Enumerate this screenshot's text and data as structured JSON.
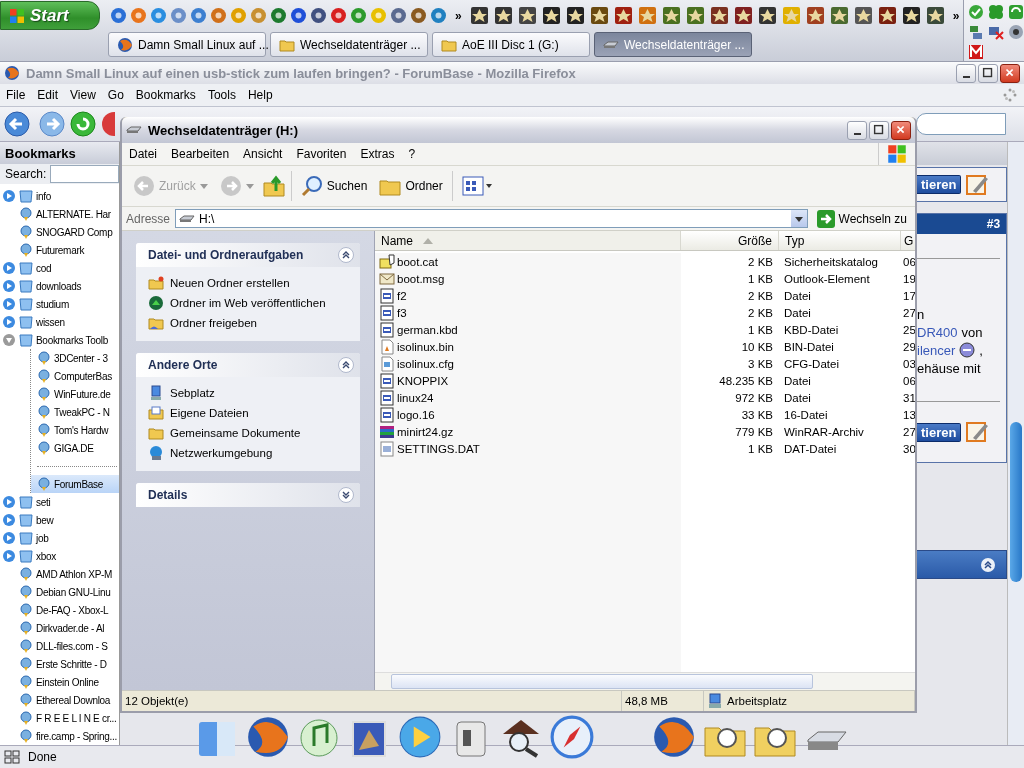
{
  "taskbar": {
    "start": "Start",
    "overflow_marks": [
      "»",
      "»"
    ],
    "tasks": [
      {
        "label": "Damn Small Linux auf ...",
        "kind": "browser",
        "selected": false
      },
      {
        "label": "Wechseldatenträger ...",
        "kind": "folder",
        "selected": false
      },
      {
        "label": "AoE III Disc 1 (G:)",
        "kind": "folder",
        "selected": false
      },
      {
        "label": "Wechseldatenträger ...",
        "kind": "drive",
        "selected": true
      }
    ]
  },
  "browser": {
    "title": "Damn Small Linux auf einen usb-stick zum laufen bringen? - ForumBase - Mozilla Firefox",
    "menu": [
      "File",
      "Edit",
      "View",
      "Go",
      "Bookmarks",
      "Tools",
      "Help"
    ],
    "sidebar": {
      "title": "Bookmarks",
      "search_label": "Search:",
      "items": [
        {
          "label": "info",
          "kind": "folder",
          "expanded": false
        },
        {
          "label": "ALTERNATE. Har",
          "kind": "link",
          "selected": false
        },
        {
          "label": "SNOGARD Comp",
          "kind": "link",
          "selected": false
        },
        {
          "label": "Futuremark",
          "kind": "link",
          "selected": false
        },
        {
          "label": "cod",
          "kind": "folder",
          "expanded": false
        },
        {
          "label": "downloads",
          "kind": "folder",
          "expanded": false
        },
        {
          "label": "studium",
          "kind": "folder",
          "expanded": false
        },
        {
          "label": "wissen",
          "kind": "folder",
          "expanded": false
        },
        {
          "label": "Bookmarks Toolb",
          "kind": "folder",
          "expanded": true,
          "children": [
            {
              "label": "3DCenter - 3",
              "kind": "link",
              "selected": false
            },
            {
              "label": "ComputerBas",
              "kind": "link",
              "selected": false
            },
            {
              "label": "WinFuture.de",
              "kind": "link",
              "selected": false
            },
            {
              "label": "TweakPC - N",
              "kind": "link",
              "selected": false
            },
            {
              "label": "Tom's Hardw",
              "kind": "link",
              "selected": false
            },
            {
              "label": "GIGA.DE",
              "kind": "link",
              "selected": false
            },
            {
              "kind": "separator"
            },
            {
              "label": "ForumBase",
              "kind": "link",
              "selected": true
            }
          ]
        },
        {
          "label": "seti",
          "kind": "folder",
          "expanded": false
        },
        {
          "label": "bew",
          "kind": "folder",
          "expanded": false
        },
        {
          "label": "job",
          "kind": "folder",
          "expanded": false
        },
        {
          "label": "xbox",
          "kind": "folder",
          "expanded": false
        },
        {
          "label": "AMD Athlon XP-M",
          "kind": "link",
          "selected": false
        },
        {
          "label": "Debian GNU-Linu",
          "kind": "link",
          "selected": false
        },
        {
          "label": "De-FAQ - Xbox-L",
          "kind": "link",
          "selected": false
        },
        {
          "label": "Dirkvader.de - Al",
          "kind": "link",
          "selected": false
        },
        {
          "label": "DLL-files.com - S",
          "kind": "link",
          "selected": false
        },
        {
          "label": "Erste Schritte - D",
          "kind": "link",
          "selected": false
        },
        {
          "label": "Einstein Online",
          "kind": "link",
          "selected": false
        },
        {
          "label": "Ethereal Downloa",
          "kind": "link",
          "selected": false
        },
        {
          "label": "F R E E L I N E cr...",
          "kind": "link",
          "selected": false
        },
        {
          "label": "fire.camp - Spring...",
          "kind": "link",
          "selected": false
        }
      ]
    },
    "page": {
      "buttons": [
        "tieren",
        "tieren"
      ],
      "post_number": "#3",
      "lines": [
        [
          {
            "kind": "text",
            "text": "n"
          }
        ],
        [
          {
            "kind": "link",
            "text": "DR400"
          },
          {
            "kind": "text",
            "text": "von"
          }
        ],
        [
          {
            "kind": "link",
            "text": "ilencer"
          },
          {
            "kind": "smiley"
          },
          {
            "kind": "text",
            "text": ","
          }
        ],
        [
          {
            "kind": "text",
            "text": "ehäuse mit"
          }
        ]
      ]
    },
    "status": "Done"
  },
  "explorer": {
    "title": "Wechseldatenträger (H:)",
    "menu": [
      "Datei",
      "Bearbeiten",
      "Ansicht",
      "Favoriten",
      "Extras",
      "?"
    ],
    "toolbar": {
      "back": {
        "label": "Zurück",
        "disabled": true
      },
      "forward": {
        "disabled": true
      },
      "search": "Suchen",
      "folders": "Ordner"
    },
    "address": {
      "label": "Adresse",
      "value": "H:\\",
      "go": "Wechseln zu"
    },
    "panels": [
      {
        "title": "Datei- und Ordneraufgaben",
        "expanded": true,
        "items": [
          {
            "label": "Neuen Ordner erstellen",
            "kind": "newfolder"
          },
          {
            "label": "Ordner im Web veröffentlichen",
            "kind": "publish"
          },
          {
            "label": "Ordner freigeben",
            "kind": "share"
          }
        ]
      },
      {
        "title": "Andere Orte",
        "expanded": true,
        "items": [
          {
            "label": "Sebplatz",
            "kind": "computer"
          },
          {
            "label": "Eigene Dateien",
            "kind": "documents"
          },
          {
            "label": "Gemeinsame Dokumente",
            "kind": "folder"
          },
          {
            "label": "Netzwerkumgebung",
            "kind": "network"
          }
        ]
      },
      {
        "title": "Details",
        "expanded": false
      }
    ],
    "columns": [
      {
        "label": "Name",
        "sorted": true
      },
      {
        "label": "Größe",
        "sorted": false
      },
      {
        "label": "Typ",
        "sorted": false
      },
      {
        "label": "G",
        "sorted": false
      }
    ],
    "files": [
      {
        "name": "boot.cat",
        "size": "2 KB",
        "type": "Sicherheitskatalog",
        "column_4": "06",
        "kind": "catalog"
      },
      {
        "name": "boot.msg",
        "size": "1 KB",
        "type": "Outlook-Element",
        "column_4": "19",
        "kind": "mail"
      },
      {
        "name": "f2",
        "size": "2 KB",
        "type": "Datei",
        "column_4": "17",
        "kind": "system"
      },
      {
        "name": "f3",
        "size": "2 KB",
        "type": "Datei",
        "column_4": "27",
        "kind": "system"
      },
      {
        "name": "german.kbd",
        "size": "1 KB",
        "type": "KBD-Datei",
        "column_4": "25",
        "kind": "system"
      },
      {
        "name": "isolinux.bin",
        "size": "10 KB",
        "type": "BIN-Datei",
        "column_4": "29",
        "kind": "bin"
      },
      {
        "name": "isolinux.cfg",
        "size": "3 KB",
        "type": "CFG-Datei",
        "column_4": "03",
        "kind": "config"
      },
      {
        "name": "KNOPPIX",
        "size": "48.235 KB",
        "type": "Datei",
        "column_4": "06",
        "kind": "system"
      },
      {
        "name": "linux24",
        "size": "972 KB",
        "type": "Datei",
        "column_4": "31",
        "kind": "system"
      },
      {
        "name": "logo.16",
        "size": "33 KB",
        "type": "16-Datei",
        "column_4": "13",
        "kind": "system"
      },
      {
        "name": "minirt24.gz",
        "size": "779 KB",
        "type": "WinRAR-Archiv",
        "column_4": "27",
        "kind": "archive"
      },
      {
        "name": "SETTINGS.DAT",
        "size": "1 KB",
        "type": "DAT-Datei",
        "column_4": "30",
        "kind": "settings"
      }
    ],
    "status": [
      "12 Objekt(e)",
      "48,8 MB",
      "Arbeitsplatz"
    ]
  }
}
